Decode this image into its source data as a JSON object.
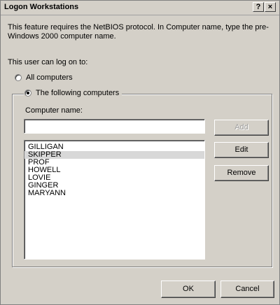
{
  "window": {
    "title": "Logon Workstations",
    "help_glyph": "?",
    "close_glyph": "×"
  },
  "intro_text": "This feature requires the NetBIOS protocol. In Computer name, type the pre-Windows 2000 computer name.",
  "logon_label": "This user can log on to:",
  "options": {
    "all": "All computers",
    "following": "The following computers",
    "selected": "following"
  },
  "computer_name": {
    "label": "Computer name:",
    "value": "",
    "placeholder": ""
  },
  "computers": [
    {
      "name": "GILLIGAN",
      "selected": false
    },
    {
      "name": "SKIPPER",
      "selected": true
    },
    {
      "name": "PROF",
      "selected": false
    },
    {
      "name": "HOWELL",
      "selected": false
    },
    {
      "name": "LOVIE",
      "selected": false
    },
    {
      "name": "GINGER",
      "selected": false
    },
    {
      "name": "MARYANN",
      "selected": false
    }
  ],
  "buttons": {
    "add": "Add",
    "edit": "Edit",
    "remove": "Remove",
    "ok": "OK",
    "cancel": "Cancel"
  }
}
